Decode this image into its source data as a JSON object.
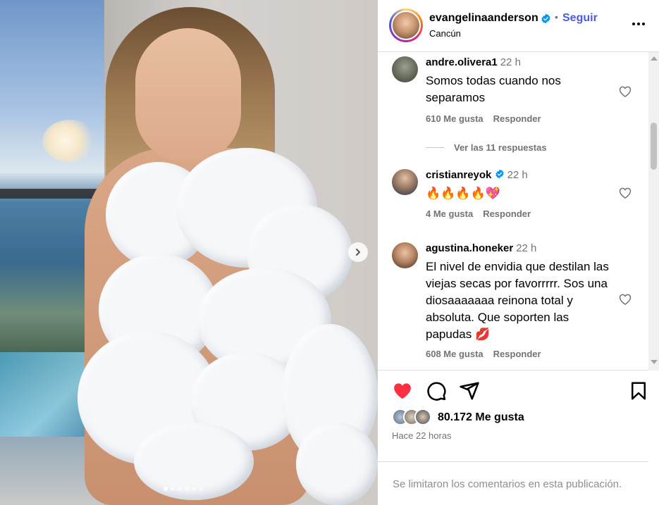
{
  "post": {
    "username": "evangelinaanderson",
    "follow_label": "Seguir",
    "separator": "•",
    "location": "Cancún",
    "carousel": {
      "total": 6,
      "active": 1
    }
  },
  "comments": [
    {
      "username": "andre.olivera1",
      "time": "22 h",
      "text": "Somos todas cuando nos separamos",
      "likes": "610 Me gusta",
      "reply_label": "Responder",
      "verified": false
    },
    {
      "username": "cristianreyok",
      "time": "22 h",
      "text": "🔥🔥🔥🔥💖",
      "likes": "4 Me gusta",
      "reply_label": "Responder",
      "verified": true
    },
    {
      "username": "agustina.honeker",
      "time": "22 h",
      "text": "El nivel de envidia que destilan las viejas secas por favorrrrr. Sos una diosaaaaaaa reinona total y absoluta. Que soporten las papudas 💋",
      "likes": "608 Me gusta",
      "reply_label": "Responder",
      "verified": false
    }
  ],
  "view_replies": "Ver las 11 respuestas",
  "likes": {
    "count_label": "80.172 Me gusta"
  },
  "posted": "Hace 22 horas",
  "comments_disabled": "Se limitaron los comentarios en esta publicación.",
  "colors": {
    "accent": "#4a5ddb",
    "like": "#ff3040",
    "muted": "#737373"
  },
  "icons": [
    "verified-badge-icon",
    "more-options-icon",
    "heart-icon",
    "comment-icon",
    "share-icon",
    "bookmark-icon",
    "chevron-right-icon"
  ]
}
